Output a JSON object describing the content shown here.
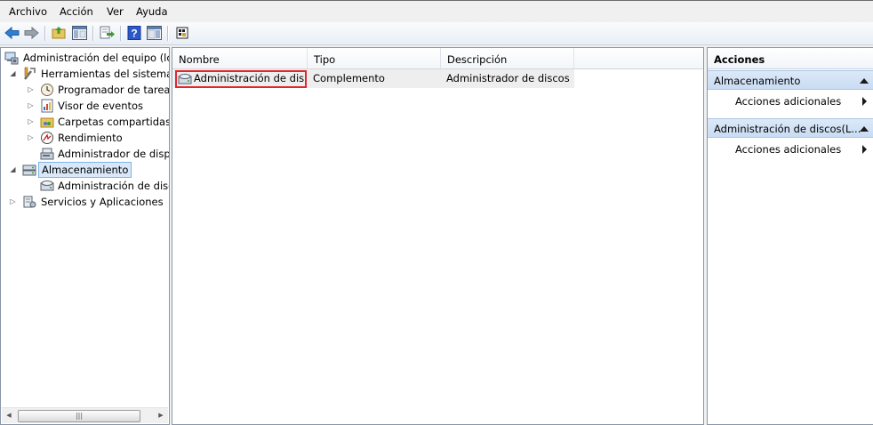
{
  "menu": [
    "Archivo",
    "Acción",
    "Ver",
    "Ayuda"
  ],
  "toolbar": {
    "buttons": [
      "back-arrow-icon",
      "forward-arrow-icon",
      "up-folder-icon",
      "show-hide-console-tree-icon",
      "export-list-icon",
      "help-icon",
      "show-hide-action-pane-icon",
      "properties-icon"
    ]
  },
  "tree": {
    "root": "Administración del equipo (local)",
    "herramientas": "Herramientas del sistema",
    "programador": "Programador de tareas",
    "visor": "Visor de eventos",
    "carpetas": "Carpetas compartidas",
    "rendimiento": "Rendimiento",
    "admin_dispositivos": "Administrador de dispositivos",
    "almacenamiento": "Almacenamiento",
    "admin_discos": "Administración de discos",
    "servicios": "Servicios y Aplicaciones"
  },
  "list": {
    "columns": [
      "Nombre",
      "Tipo",
      "Descripción"
    ],
    "rows": [
      {
        "nombre": "Administración de dis...",
        "tipo": "Complemento",
        "descripcion": "Administrador de discos..."
      }
    ]
  },
  "actions": {
    "title": "Acciones",
    "sections": [
      {
        "label": "Almacenamiento",
        "item": "Acciones adicionales"
      },
      {
        "label": "Administración de discos(L...",
        "item": "Acciones adicionales"
      }
    ]
  },
  "colors": {
    "selection": "#d9e8f9",
    "highlight_box": "#e3262b",
    "action_header": "#c9dcf3"
  }
}
